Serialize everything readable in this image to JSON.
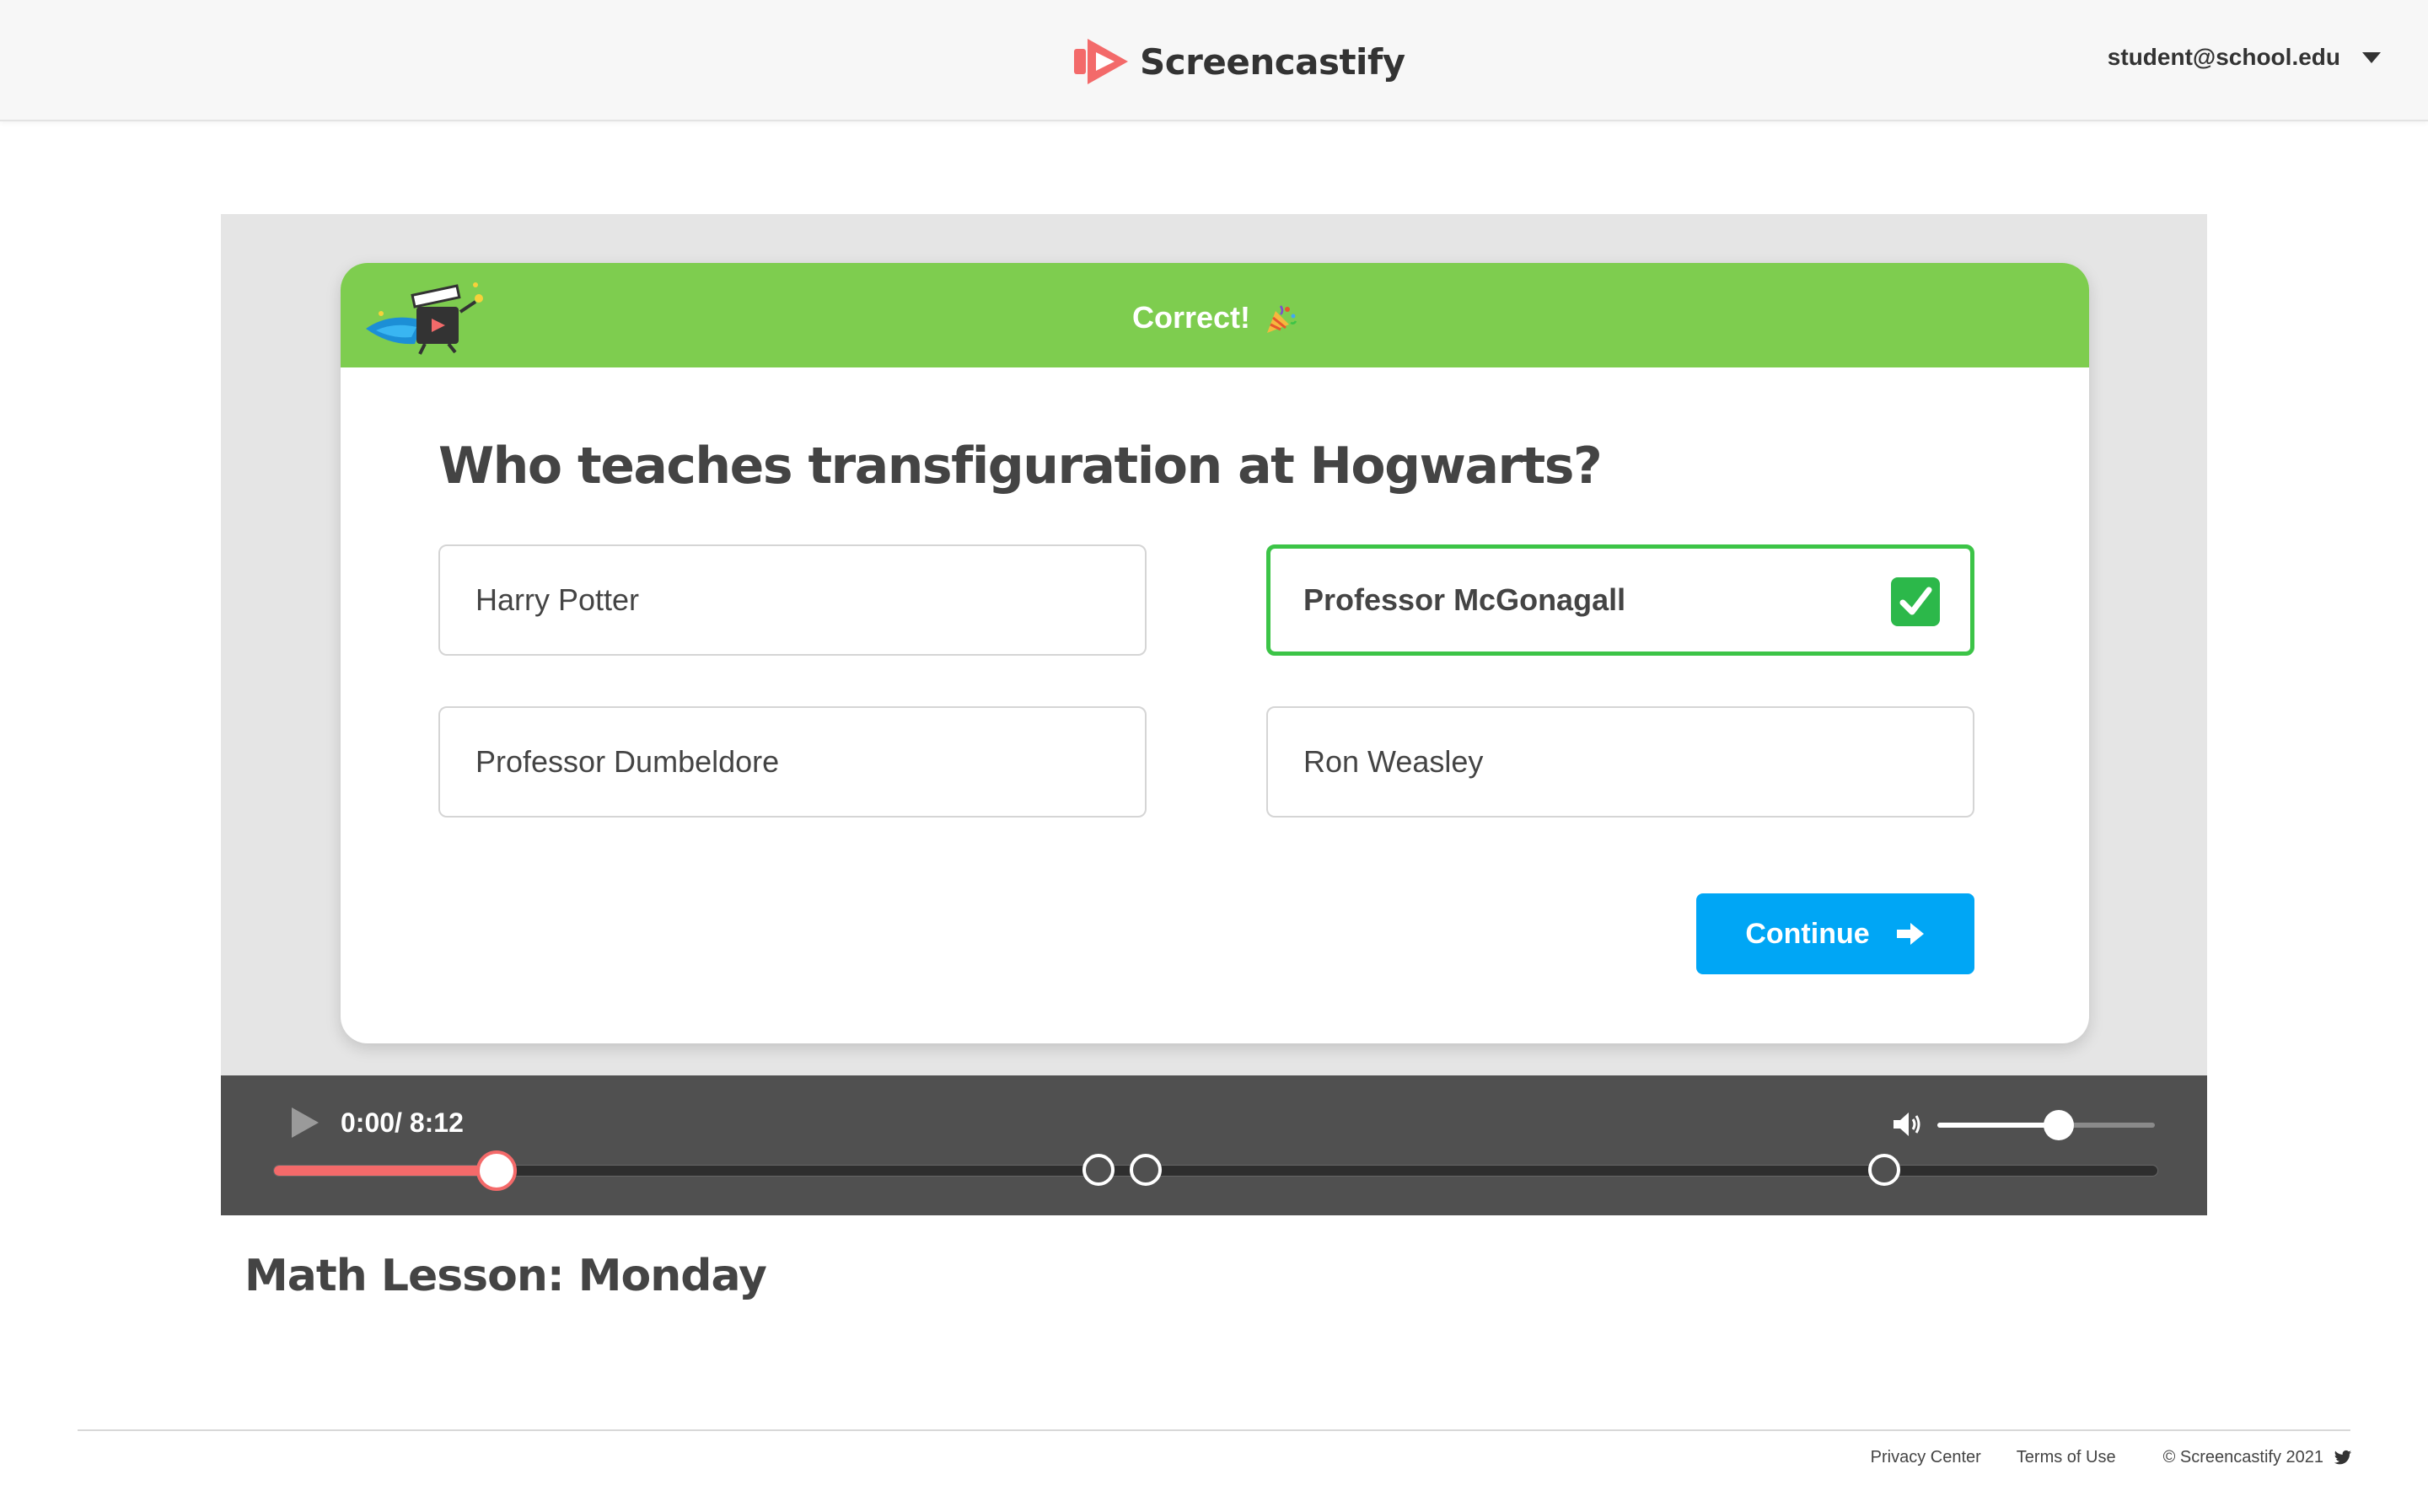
{
  "header": {
    "brand": "Screencastify",
    "account_email": "student@school.edu"
  },
  "quiz": {
    "banner_text": "Correct!",
    "question": "Who teaches transfiguration at Hogwarts?",
    "answers": [
      {
        "label": "Harry Potter",
        "correct": false
      },
      {
        "label": "Professor McGonagall",
        "correct": true
      },
      {
        "label": "Professor Dumbeldore",
        "correct": false
      },
      {
        "label": "Ron Weasley",
        "correct": false
      }
    ],
    "continue_label": "Continue"
  },
  "player": {
    "time": "0:00/ 8:12",
    "progress_fraction": 0.118,
    "volume_fraction": 0.56,
    "question_markers_fraction": [
      0.438,
      0.463,
      0.855
    ]
  },
  "video": {
    "title": "Math Lesson: Monday"
  },
  "footer": {
    "privacy": "Privacy Center",
    "terms": "Terms of Use",
    "copyright": "© Screencastify 2021"
  },
  "colors": {
    "banner_green": "#7ecd4f",
    "correct_border": "#3cc447",
    "continue_blue": "#00a6f5",
    "progress_red": "#f46a6a",
    "player_bg": "#505050"
  }
}
